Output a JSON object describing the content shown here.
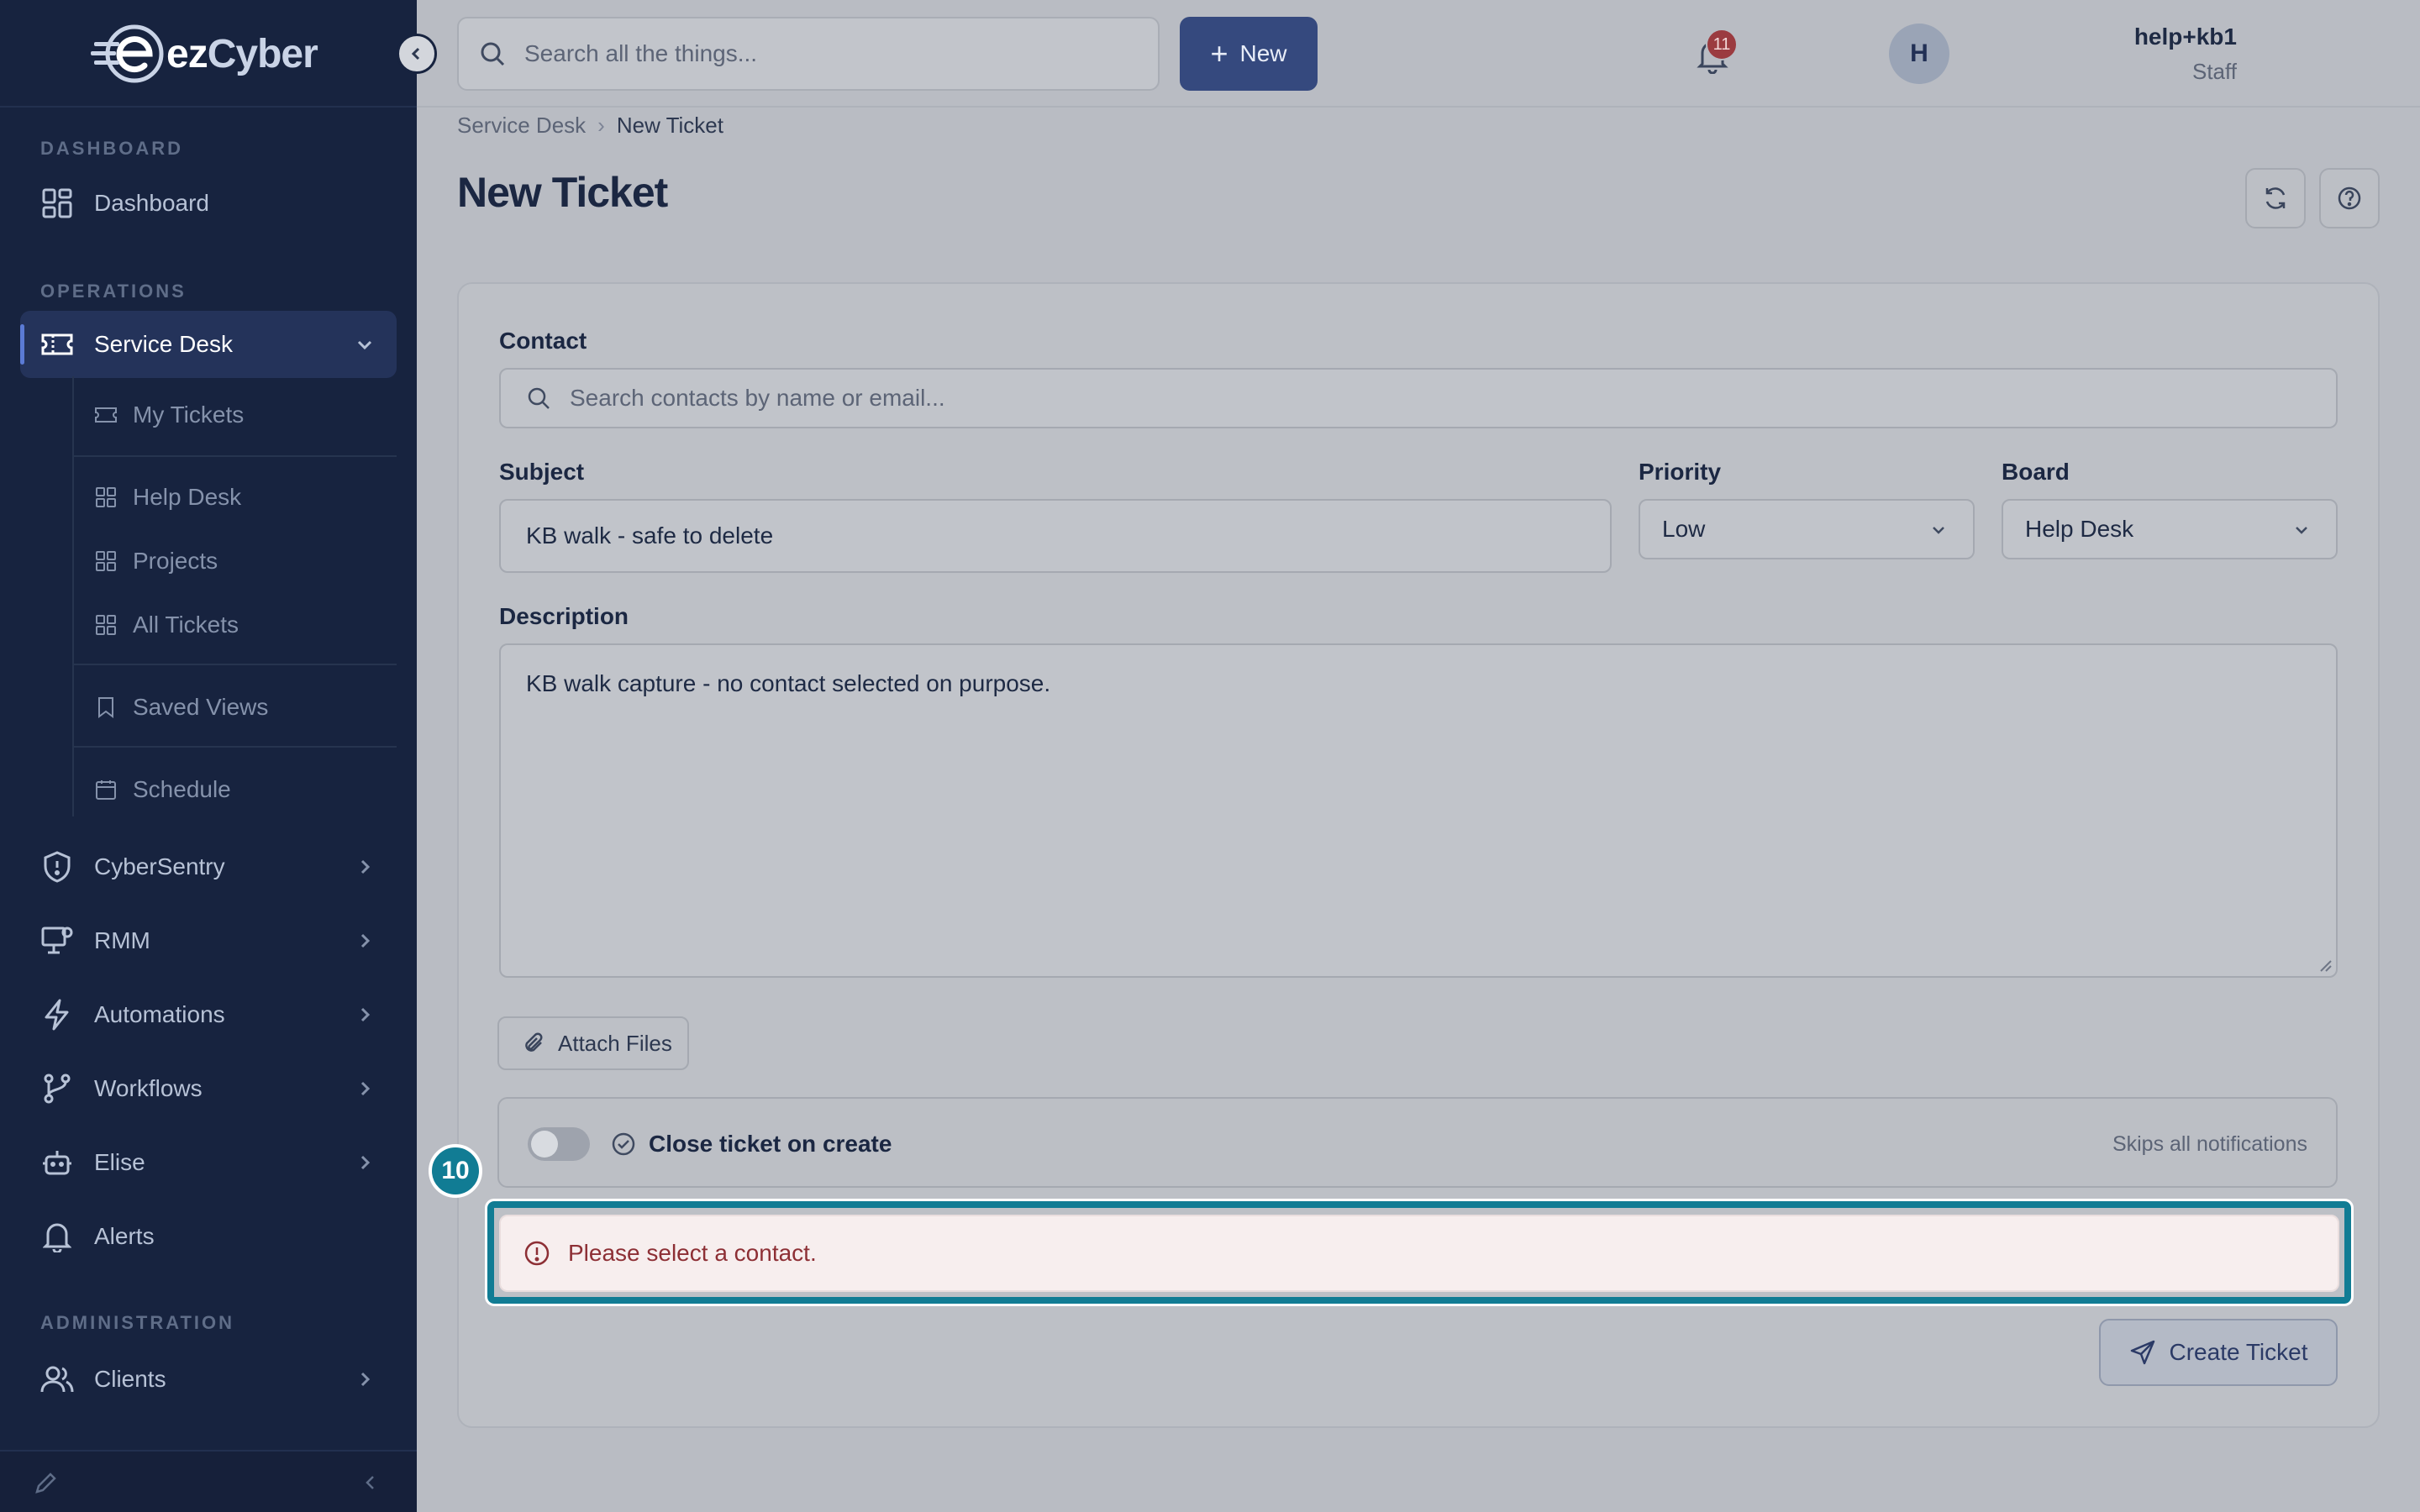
{
  "brand": {
    "name_prefix": "ez",
    "name_suffix": "Cyber"
  },
  "sidebar": {
    "sections": {
      "dashboard": "DASHBOARD",
      "operations": "OPERATIONS",
      "administration": "ADMINISTRATION"
    },
    "items": {
      "dashboard": "Dashboard",
      "service_desk": "Service Desk",
      "cybersentry": "CyberSentry",
      "rmm": "RMM",
      "automations": "Automations",
      "workflows": "Workflows",
      "elise": "Elise",
      "alerts": "Alerts",
      "clients": "Clients"
    },
    "sub_items": {
      "my_tickets": "My Tickets",
      "help_desk": "Help Desk",
      "projects": "Projects",
      "all_tickets": "All Tickets",
      "saved_views": "Saved Views",
      "schedule": "Schedule"
    }
  },
  "topbar": {
    "search_placeholder": "Search all the things...",
    "new_label": "New",
    "notification_count": "11",
    "user_name": "help+kb1",
    "user_role": "Staff",
    "avatar_initial": "H"
  },
  "breadcrumb": {
    "parent": "Service Desk",
    "current": "New Ticket"
  },
  "page": {
    "title": "New Ticket"
  },
  "form": {
    "contact_label": "Contact",
    "contact_placeholder": "Search contacts by name or email...",
    "subject_label": "Subject",
    "subject_value": "KB walk - safe to delete",
    "priority_label": "Priority",
    "priority_value": "Low",
    "board_label": "Board",
    "board_value": "Help Desk",
    "description_label": "Description",
    "description_value": "KB walk capture - no contact selected on purpose.",
    "attach_label": "Attach Files",
    "close_on_create_label": "Close ticket on create",
    "close_on_create_note": "Skips all notifications",
    "close_on_create_enabled": false,
    "error_message": "Please select a contact.",
    "submit_label": "Create Ticket"
  },
  "annotation": {
    "step_number": "10"
  },
  "colors": {
    "sidebar_bg": "#17233f",
    "accent": "#35497e",
    "highlight": "#117c94",
    "error_text": "#8d2f35"
  }
}
